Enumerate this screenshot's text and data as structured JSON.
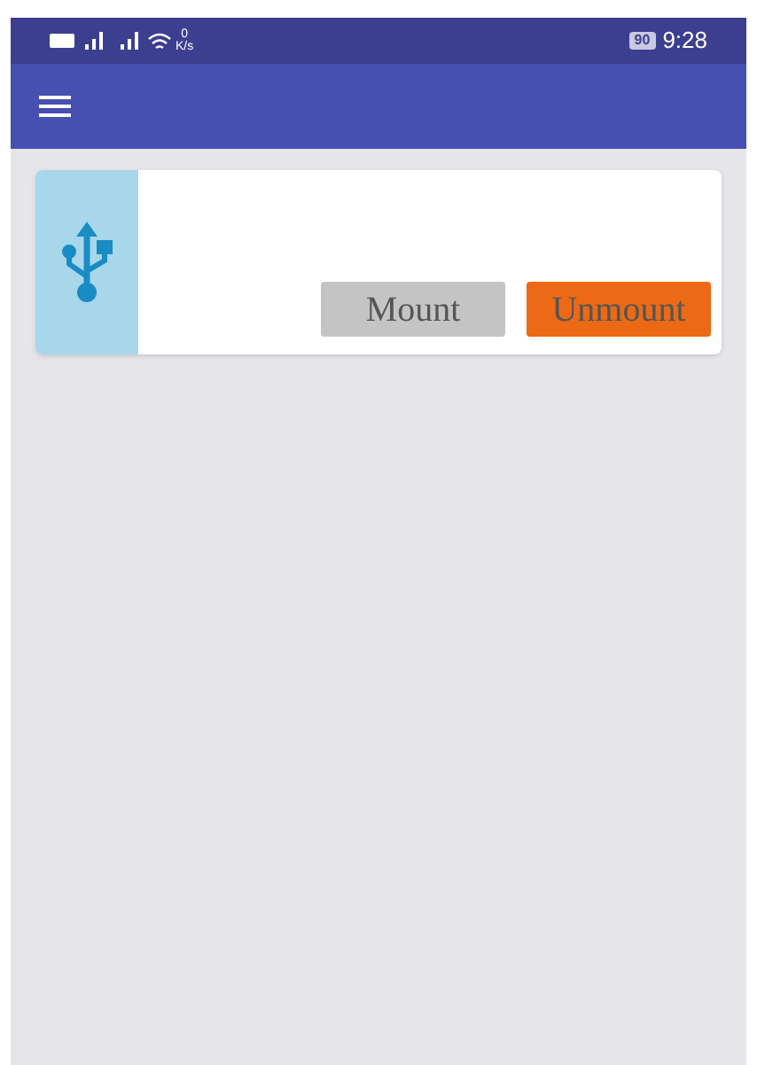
{
  "status_bar": {
    "speed_value": "0",
    "speed_unit": "K/s",
    "battery": "90",
    "time": "9:28"
  },
  "device_card": {
    "buttons": [
      {
        "label": "Mount",
        "kind": "neutral"
      },
      {
        "label": "Unmount",
        "kind": "accent"
      }
    ]
  }
}
